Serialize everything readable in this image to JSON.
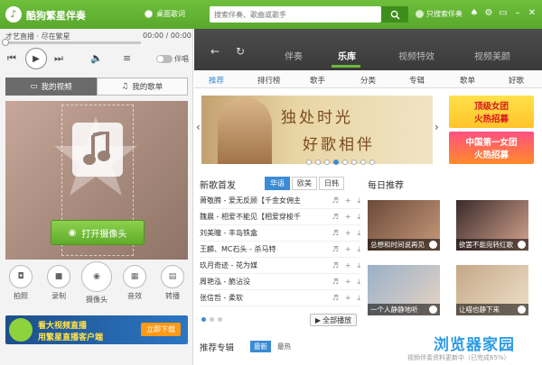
{
  "app": {
    "title": "酷狗繁星伴奏",
    "desk_lyrics": "桌面歌词",
    "search_placeholder": "搜索伴奏、歌曲或歌手",
    "only_search_label": "只搜索伴奏",
    "window_controls": [
      "shirt-icon",
      "settings-icon",
      "minimize-icon",
      "maximize-icon",
      "close-icon"
    ]
  },
  "player": {
    "now_playing": "才艺直播 · 尽在繁星",
    "time": "00:00 / 00:00",
    "progress_pct": 0,
    "toggle_label": "伴唱"
  },
  "left": {
    "tabs": [
      {
        "label": "我的视频",
        "active": true
      },
      {
        "label": "我的歌单",
        "active": false
      }
    ],
    "camera_button": "打开摄像头",
    "tools": [
      {
        "icon": "camera-icon",
        "label": "拍照"
      },
      {
        "icon": "video-record-icon",
        "label": "录制"
      },
      {
        "icon": "webcam-icon",
        "label": "摄像头"
      },
      {
        "icon": "sound-effect-icon",
        "label": "音效"
      },
      {
        "icon": "relay-icon",
        "label": "转播"
      }
    ],
    "banner": {
      "line1": "看大视频直播",
      "line2": "用繁星直播客户端",
      "button": "立即下载"
    }
  },
  "nav": {
    "tabs": [
      {
        "label": "伴奏",
        "active": false
      },
      {
        "label": "乐库",
        "active": true
      },
      {
        "label": "视频特效",
        "active": false
      },
      {
        "label": "视频美颜",
        "active": false
      }
    ]
  },
  "categories": [
    "推荐",
    "排行榜",
    "歌手",
    "分类",
    "专辑",
    "歌单",
    "好歌"
  ],
  "carousel": {
    "line1": "独处时光",
    "line2": "好歌相伴",
    "dots": 8,
    "active_dot": 3,
    "promo1": "顶级女团\n火热招募",
    "promo2": "中国第一女团\n火热招募"
  },
  "new_songs": {
    "title": "新歌首发",
    "tabs": [
      {
        "label": "华语",
        "active": true
      },
      {
        "label": "欧美",
        "active": false
      },
      {
        "label": "日韩",
        "active": false
      }
    ],
    "rows": [
      "萧敬腾 - 爱无反顾【千金女佣主",
      "魏晨 - 相爱不能见【相爱穿梭千",
      "刘美瞳 - 丰岛铁盒",
      "王麟、MC石头 - 杀马特",
      "玖月奇迹 - 花为媒",
      "周艳泓 - 脆沾没",
      "张信哲 - 柔软"
    ],
    "play_all": "全部播放"
  },
  "daily": {
    "title": "每日推荐",
    "cards": [
      {
        "caption": "总想和时间说再见"
      },
      {
        "caption": "欲罢不能宛转红歌"
      },
      {
        "caption": "一个人静静地听"
      },
      {
        "caption": "让喵也静下来"
      }
    ]
  },
  "recommend": {
    "title": "推荐专辑",
    "tabs": [
      {
        "label": "最新",
        "active": true
      },
      {
        "label": "最热",
        "active": false
      }
    ]
  },
  "footer_status": "视频伴奏资料更新中（已完成65%）",
  "watermark": "浏览器家园",
  "colors": {
    "brand_green": "#58a82c",
    "accent_blue": "#3b8bd6",
    "nav_dark": "#3a3a3a"
  }
}
